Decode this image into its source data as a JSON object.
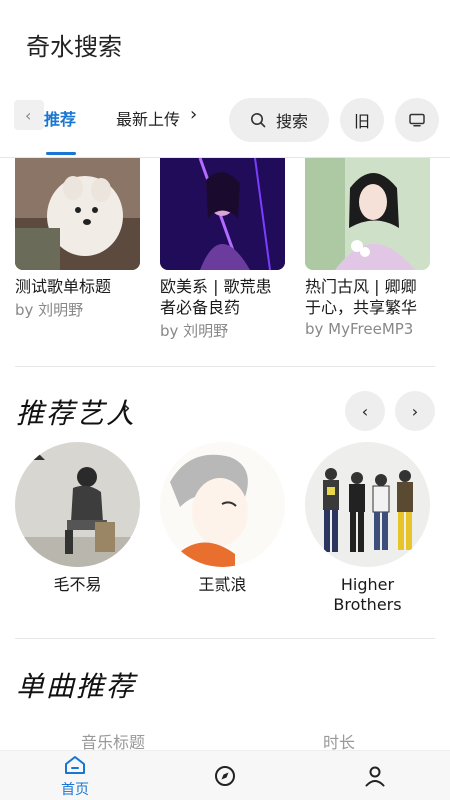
{
  "app": {
    "title": "奇水搜索"
  },
  "nav": {
    "tabs": [
      {
        "label": "推荐",
        "active": true
      },
      {
        "label": "最新上传",
        "active": false
      }
    ],
    "search_label": "搜索",
    "history_label": "旧"
  },
  "playlists": [
    {
      "title": "测试歌单标题",
      "author": "by 刘明野"
    },
    {
      "title": "欧美系 | 歌荒患者必备良药",
      "author": "by 刘明野"
    },
    {
      "title": "热门古风 | 卿卿于心，共享繁华",
      "author": "by MyFreeMP3"
    }
  ],
  "artists_section": {
    "title": "推荐艺人"
  },
  "artists": [
    {
      "name": "毛不易"
    },
    {
      "name": "王贰浪"
    },
    {
      "name": "Higher Brothers"
    }
  ],
  "songs_section": {
    "title": "单曲推荐",
    "columns": {
      "title": "音乐标题",
      "duration": "时长"
    }
  },
  "bottom_nav": {
    "home_label": "首页",
    "active_color": "#1976d2"
  },
  "colors": {
    "accent": "#1976d2",
    "pill_bg": "#eeeeee"
  }
}
